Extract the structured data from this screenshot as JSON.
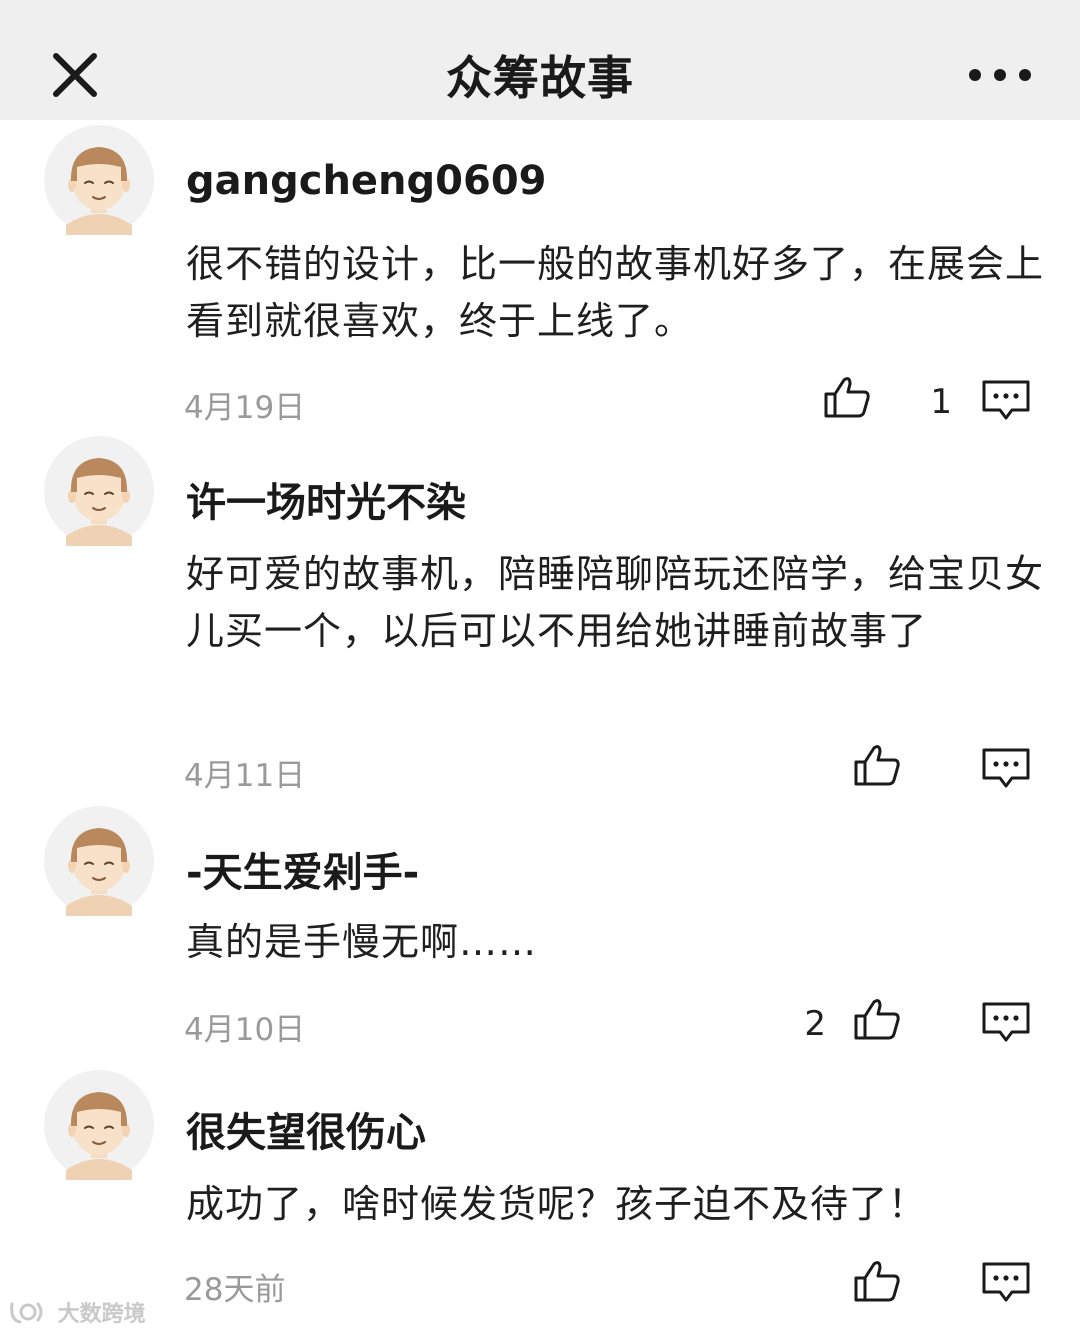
{
  "header": {
    "title": "众筹故事",
    "close_icon": "close-icon",
    "more_icon": "more-icon"
  },
  "comments": [
    {
      "username": "gangcheng0609",
      "content": "很不错的设计，比一般的故事机好多了，在展会上看到就很喜欢，终于上线了。",
      "date": "4月19日",
      "likes": "1"
    },
    {
      "username": "许一场时光不染",
      "content": "好可爱的故事机，陪睡陪聊陪玩还陪学，给宝贝女儿买一个，以后可以不用给她讲睡前故事了",
      "date": "4月11日",
      "likes": ""
    },
    {
      "username": "-天生爱剁手-",
      "content": "真的是手慢无啊……",
      "date": "4月10日",
      "likes": "2"
    },
    {
      "username": "很失望很伤心",
      "content": "成功了，啥时候发货呢？孩子迫不及待了！",
      "date": "28天前",
      "likes": ""
    }
  ],
  "watermark": {
    "text": "大数跨境"
  },
  "colors": {
    "header_bg": "#efefef",
    "text": "#1c1c1c",
    "date": "#9a9a9a",
    "icon": "#1a1a1a"
  }
}
